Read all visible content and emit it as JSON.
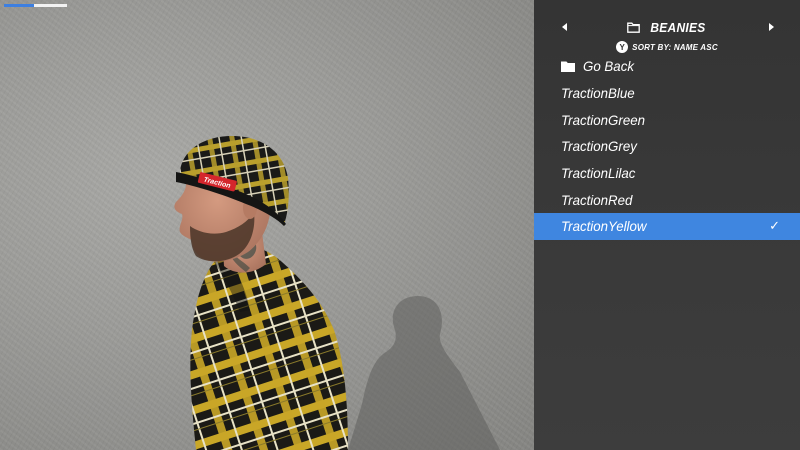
{
  "loading": {
    "progress": 0.48
  },
  "menu": {
    "category": "BEANIES",
    "sort_key": "Y",
    "sort_label": "SORT BY: NAME ASC",
    "back_label": "Go Back",
    "items": [
      {
        "label": "TractionBlue"
      },
      {
        "label": "TractionGreen"
      },
      {
        "label": "TractionGrey"
      },
      {
        "label": "TractionLilac"
      },
      {
        "label": "TractionRed"
      },
      {
        "label": "TractionYellow"
      }
    ],
    "selected_index": 5,
    "check_glyph": "✓"
  },
  "colors": {
    "accent": "#3f86e0",
    "panel": "#383838",
    "wall": "#9c9c99"
  },
  "character": {
    "beanie_patch_text": "Traction"
  }
}
